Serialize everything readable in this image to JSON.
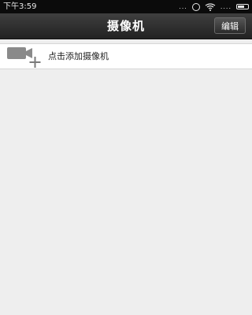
{
  "status_bar": {
    "time": "下午3:59",
    "dots": "...",
    "signal_dots": "...."
  },
  "header": {
    "title": "摄像机",
    "edit_label": "编辑"
  },
  "list": {
    "add_camera_label": "点击添加摄像机"
  },
  "colors": {
    "status_bg": "#0b0b0b",
    "nav_bg": "#2b2b2b",
    "content_bg": "#eeeeee",
    "row_bg": "#ffffff",
    "icon_gray": "#8a8a8a"
  },
  "icons": [
    "alarm-icon",
    "wifi-icon",
    "signal-icon",
    "battery-icon",
    "video-camera-add-icon"
  ]
}
